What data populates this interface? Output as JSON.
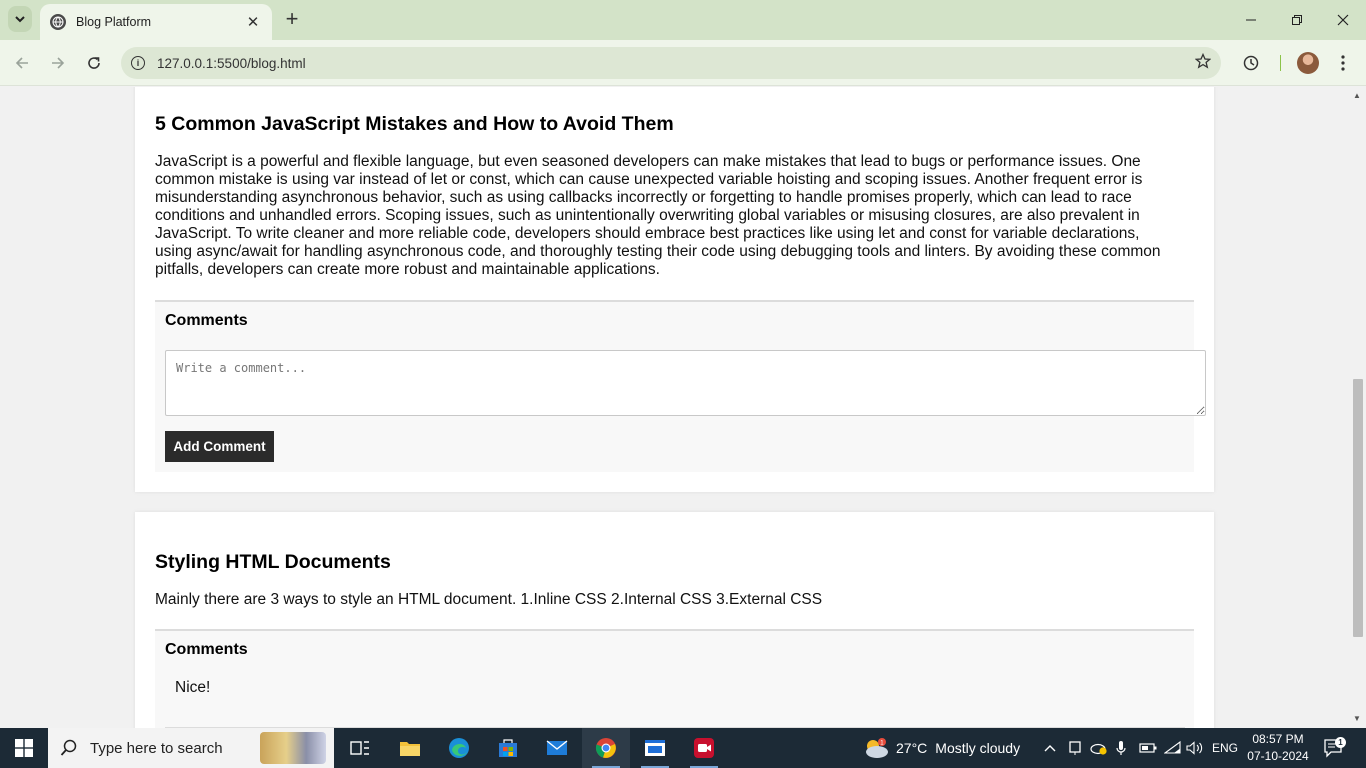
{
  "browser": {
    "tab_title": "Blog Platform",
    "url": "127.0.0.1:5500/blog.html"
  },
  "posts": [
    {
      "title": "5 Common JavaScript Mistakes and How to Avoid Them",
      "lines": [
        "JavaScript is a powerful and flexible language, but even seasoned developers can make mistakes that lead to bugs or performance issues. One",
        "common mistake is using var instead of let or const, which can cause unexpected variable hoisting and scoping issues. Another frequent error is",
        "misunderstanding asynchronous behavior, such as using callbacks incorrectly or forgetting to handle promises properly, which can lead to race",
        "conditions and unhandled errors. Scoping issues, such as unintentionally overwriting global variables or misusing closures, are also prevalent in",
        "JavaScript. To write cleaner and more reliable code, developers should embrace best practices like using let and const for variable declarations,",
        "using async/await for handling asynchronous code, and thoroughly testing their code using debugging tools and linters. By avoiding these common",
        "pitfalls, developers can create more robust and maintainable applications."
      ],
      "comments_heading": "Comments",
      "comment_placeholder": "Write a comment...",
      "add_comment_label": "Add Comment"
    },
    {
      "title": "Styling HTML Documents",
      "content": "Mainly there are 3 ways to style an HTML document. 1.Inline CSS 2.Internal CSS 3.External CSS",
      "comments_heading": "Comments",
      "comments": [
        "Nice!"
      ]
    }
  ],
  "taskbar": {
    "search_placeholder": "Type here to search",
    "weather_temp": "27°C",
    "weather_text": "Mostly cloudy",
    "language": "ENG",
    "time": "08:57 PM",
    "date": "07-10-2024",
    "notification_count": "1"
  },
  "colors": {
    "tabbar_bg": "#d3e3c8",
    "toolbar_bg": "#eff5ea",
    "page_bg": "#f1f1f1",
    "button_bg": "#2b2b2b",
    "taskbar_bg": "#1c2a36"
  }
}
